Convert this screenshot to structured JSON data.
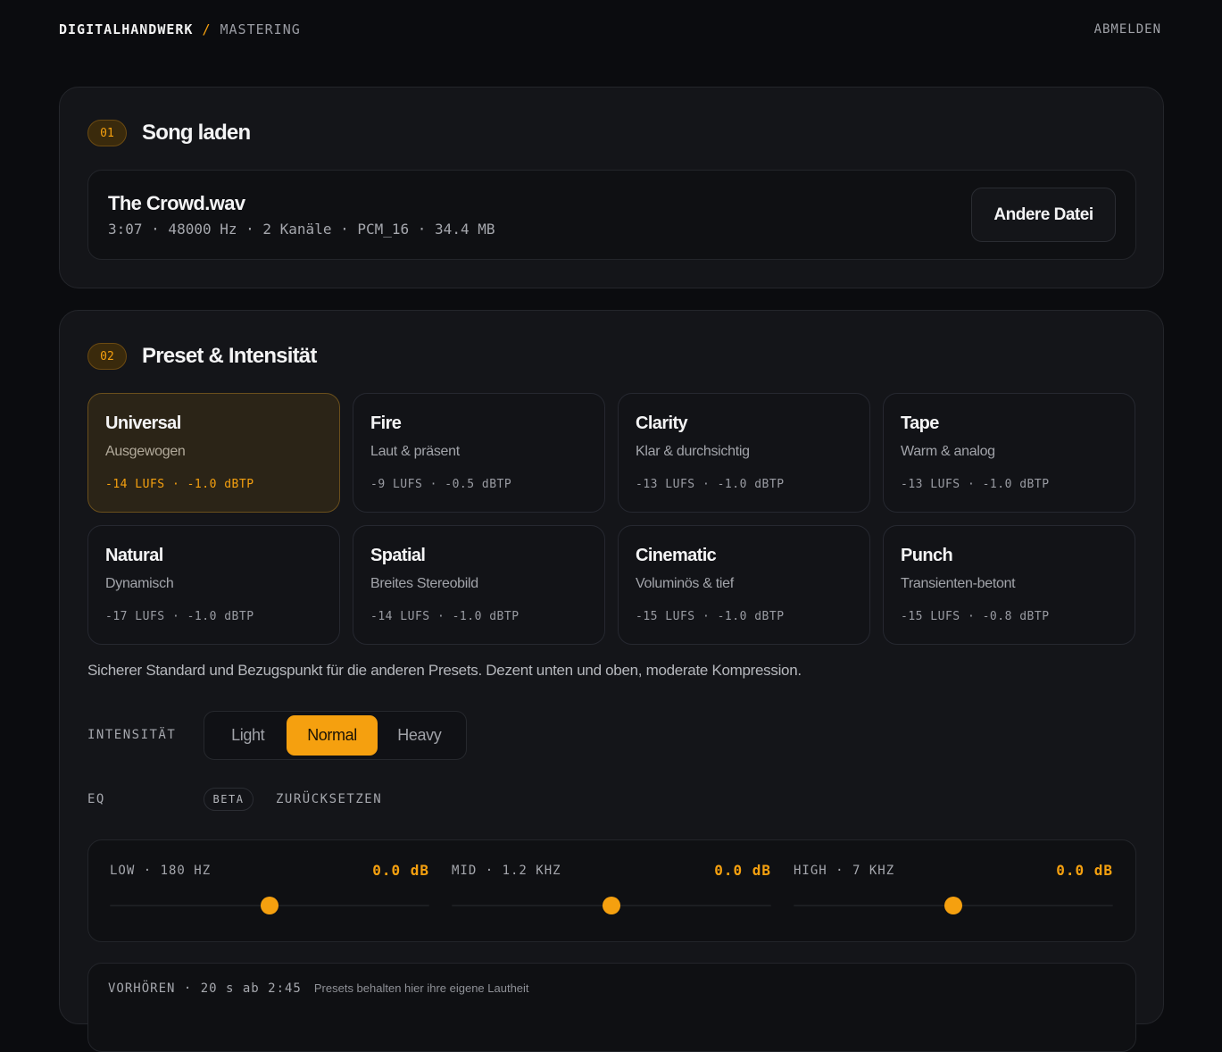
{
  "header": {
    "brand": "DIGITALHANDWERK",
    "separator": "/",
    "section": "MASTERING",
    "logout_label": "ABMELDEN"
  },
  "step1": {
    "number": "01",
    "title": "Song laden",
    "file": {
      "name": "The Crowd.wav",
      "meta": "3:07 · 48000 Hz · 2 Kanäle · PCM_16 · 34.4 MB"
    },
    "change_button": "Andere Datei"
  },
  "step2": {
    "number": "02",
    "title": "Preset & Intensität",
    "presets": [
      {
        "name": "Universal",
        "desc": "Ausgewogen",
        "spec": "-14 LUFS · -1.0 dBTP",
        "selected": true
      },
      {
        "name": "Fire",
        "desc": "Laut & präsent",
        "spec": "-9 LUFS · -0.5 dBTP",
        "selected": false
      },
      {
        "name": "Clarity",
        "desc": "Klar & durchsichtig",
        "spec": "-13 LUFS · -1.0 dBTP",
        "selected": false
      },
      {
        "name": "Tape",
        "desc": "Warm & analog",
        "spec": "-13 LUFS · -1.0 dBTP",
        "selected": false
      },
      {
        "name": "Natural",
        "desc": "Dynamisch",
        "spec": "-17 LUFS · -1.0 dBTP",
        "selected": false
      },
      {
        "name": "Spatial",
        "desc": "Breites Stereobild",
        "spec": "-14 LUFS · -1.0 dBTP",
        "selected": false
      },
      {
        "name": "Cinematic",
        "desc": "Voluminös & tief",
        "spec": "-15 LUFS · -1.0 dBTP",
        "selected": false
      },
      {
        "name": "Punch",
        "desc": "Transienten-betont",
        "spec": "-15 LUFS · -0.8 dBTP",
        "selected": false
      }
    ],
    "preset_info": "Sicherer Standard und Bezugspunkt für die anderen Presets. Dezent unten und oben, moderate Kompression.",
    "intensity": {
      "label": "INTENSITÄT",
      "options": [
        "Light",
        "Normal",
        "Heavy"
      ],
      "selected": "Normal"
    },
    "eq": {
      "label": "EQ",
      "badge": "BETA",
      "reset_label": "ZURÜCKSETZEN",
      "bands": [
        {
          "label": "LOW · 180 HZ",
          "value": "0.0 dB",
          "position": 0.5
        },
        {
          "label": "MID · 1.2 KHZ",
          "value": "0.0 dB",
          "position": 0.5
        },
        {
          "label": "HIGH · 7 KHZ",
          "value": "0.0 dB",
          "position": 0.5
        }
      ]
    },
    "preview": {
      "label": "VORHÖREN · 20 s ab 2:45",
      "note": "Presets behalten hier ihre eigene Lautheit"
    }
  },
  "colors": {
    "accent": "#f5a00f",
    "background": "#0b0c0f",
    "panel": "#141519"
  }
}
